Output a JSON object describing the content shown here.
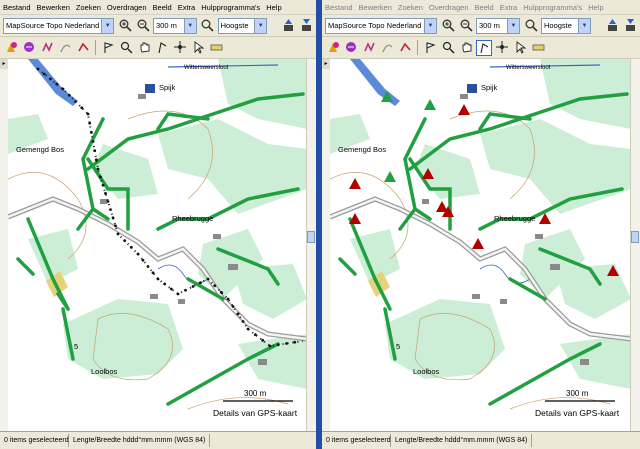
{
  "menu": [
    "Bestand",
    "Bewerken",
    "Zoeken",
    "Overdragen",
    "Beeld",
    "Extra",
    "Hulpprogramma's",
    "Help"
  ],
  "toolbar": {
    "product": "MapSource Topo Nederland",
    "zoom_value": "300 m",
    "detail": "Hoogste"
  },
  "map": {
    "label_gemengd": "Gemengd Bos",
    "label_rheebrugge": "Rheebrugge",
    "label_loolbos": "Loolbos",
    "label_spijk": "Spijk",
    "label_water": "Wittersweersloot",
    "contour_5": "5",
    "scale": "300 m",
    "details": "Details van GPS-kaart"
  },
  "left_status": {
    "items": "0 items geselecteerd",
    "coords": "Lengte/Breedte hddd°mm.mmm (WGS 84)"
  },
  "right_status": {
    "items": "0 items geselecteerd",
    "coords": "Lengte/Breedte hddd°mm.mmm (WGS 84)"
  },
  "icons": [
    "waypoint-icon",
    "route-icon",
    "track-icon",
    "zoom-in-icon",
    "zoom-out-icon",
    "pan-hand-icon",
    "select-arrow-icon",
    "ruler-icon",
    "send-to-device-icon",
    "receive-from-device-icon"
  ],
  "colors": {
    "road": "#20a040",
    "light_green": "#cdeed6",
    "route": "#b00000",
    "accent": "#1f4fa6"
  }
}
